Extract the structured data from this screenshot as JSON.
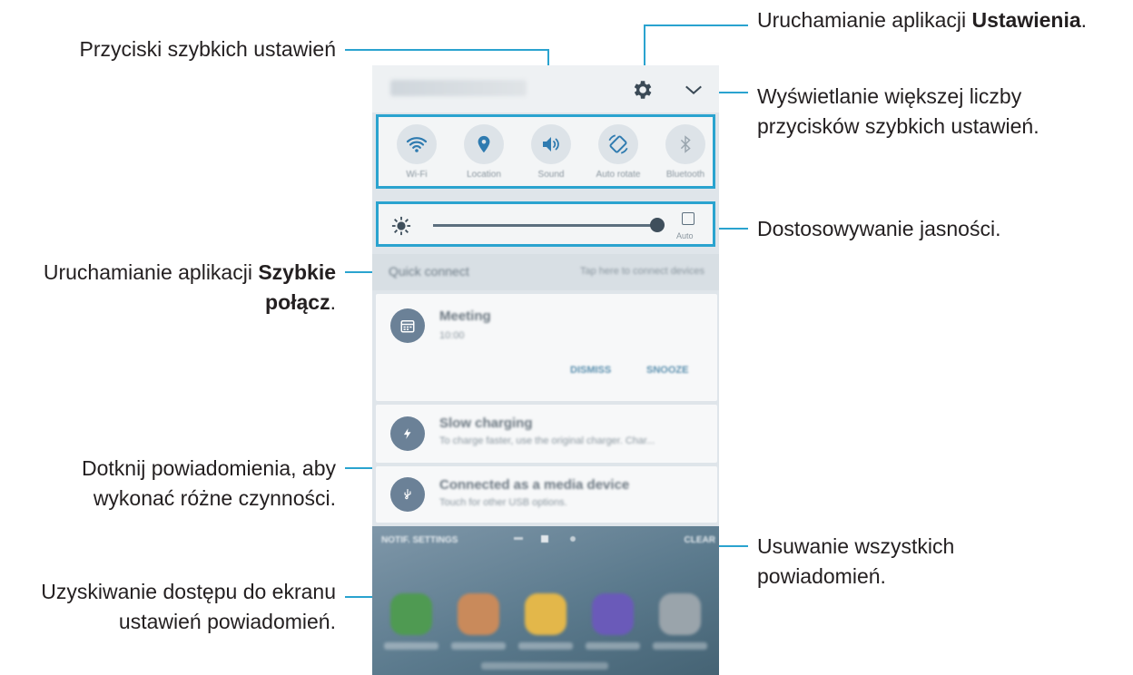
{
  "callouts": {
    "quick_buttons": "Przyciski szybkich ustawień",
    "settings_pre": "Uruchamianie aplikacji ",
    "settings_bold": "Ustawienia",
    "settings_post": ".",
    "more_line1": "Wyświetlanie większej liczby",
    "more_line2": "przycisków szybkich ustawień.",
    "brightness": "Dostosowywanie jasności.",
    "quickconnect_pre": "Uruchamianie aplikacji ",
    "quickconnect_bold1": "Szybkie",
    "quickconnect_bold2": "połącz",
    "quickconnect_post": ".",
    "notif_line1": "Dotknij powiadomienia, aby",
    "notif_line2": "wykonać różne czynności.",
    "clear_line1": "Usuwanie wszystkich",
    "clear_line2": "powiadomień.",
    "notifsettings_line1": "Uzyskiwanie dostępu do ekranu",
    "notifsettings_line2": "ustawień powiadomień."
  },
  "phone": {
    "quick_settings": [
      {
        "label": "Wi-Fi",
        "icon": "wifi-icon"
      },
      {
        "label": "Location",
        "icon": "location-icon"
      },
      {
        "label": "Sound",
        "icon": "sound-icon"
      },
      {
        "label": "Auto rotate",
        "icon": "auto-rotate-icon"
      },
      {
        "label": "Bluetooth",
        "icon": "bluetooth-icon"
      }
    ],
    "brightness": {
      "level": 0.98,
      "auto_label": "Auto"
    },
    "quick_connect": {
      "title": "Quick connect",
      "hint": "Tap here to connect devices"
    },
    "notifications": [
      {
        "title": "Meeting",
        "subtitle": "10:00",
        "actions": [
          "DISMISS",
          "SNOOZE"
        ],
        "icon": "calendar-icon"
      },
      {
        "title": "Slow charging",
        "subtitle": "To charge faster, use the original charger. Char...",
        "icon": "bolt-icon"
      },
      {
        "title": "Connected as a media device",
        "subtitle": "Touch for other USB options.",
        "icon": "usb-icon"
      }
    ],
    "bottom": {
      "notif_settings": "NOTIF. SETTINGS",
      "clear": "CLEAR"
    }
  },
  "colors": {
    "accent": "#2aa3cf"
  }
}
